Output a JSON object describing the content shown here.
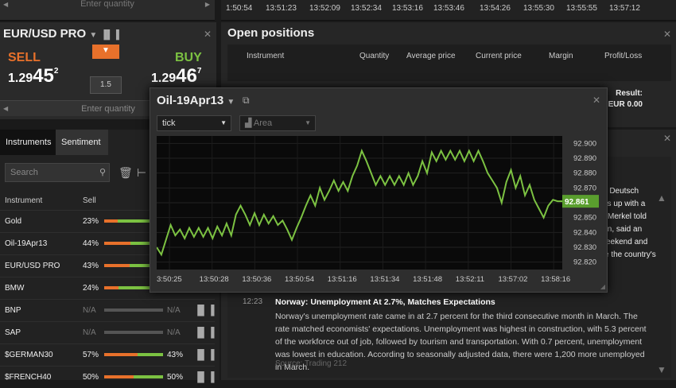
{
  "top_left": {
    "placeholder": "Enter quantity"
  },
  "top_times": [
    "1:50:54",
    "13:51:23",
    "13:52:09",
    "13:52:34",
    "13:53:16",
    "13:53:46",
    "13:54:26",
    "13:55:30",
    "13:55:55",
    "13:57:12"
  ],
  "trade": {
    "instrument": "EUR/USD PRO",
    "sell_label": "SELL",
    "buy_label": "BUY",
    "sell_big": "1.29",
    "sell_pips": "45",
    "sell_sup": "2",
    "buy_big": "1.29",
    "buy_pips": "46",
    "buy_sup": "7",
    "spread": "1.5",
    "quantity_placeholder": "Enter quantity"
  },
  "instruments_panel": {
    "tabs": [
      "Instruments",
      "Sentiment"
    ],
    "search_placeholder": "Search",
    "col_instrument": "Instrument",
    "col_sell": "Sell",
    "rows": [
      {
        "name": "Gold",
        "sell": "23%",
        "buy": "",
        "sell_frac": 0.23
      },
      {
        "name": "Oil-19Apr13",
        "sell": "44%",
        "buy": "",
        "sell_frac": 0.44
      },
      {
        "name": "EUR/USD PRO",
        "sell": "43%",
        "buy": "",
        "sell_frac": 0.43
      },
      {
        "name": "BMW",
        "sell": "24%",
        "buy": "",
        "sell_frac": 0.24
      },
      {
        "name": "BNP",
        "sell": "N/A",
        "buy": "N/A",
        "sell_frac": 0
      },
      {
        "name": "SAP",
        "sell": "N/A",
        "buy": "N/A",
        "sell_frac": 0
      },
      {
        "name": "$GERMAN30",
        "sell": "57%",
        "buy": "43%",
        "sell_frac": 0.57
      },
      {
        "name": "$FRENCH40",
        "sell": "50%",
        "buy": "50%",
        "sell_frac": 0.5
      }
    ]
  },
  "open_positions": {
    "title": "Open positions",
    "columns": [
      "Instrument",
      "Quantity",
      "Average price",
      "Current price",
      "Margin",
      "Profit/Loss"
    ],
    "result_label": "Result:",
    "result_value": "EUR 0.00"
  },
  "news": {
    "snippets": [
      "h Deutsch",
      "es up with a",
      "Merkel told",
      "lan, said an",
      "eekend and",
      "e the country's"
    ],
    "time": "12:23",
    "headline": "Norway: Unemployment At 2.7%, Matches Expectations",
    "body": "Norway's unemployment rate came in at 2.7 percent for the third consecutive month in March. The rate matched economists' expectations. Unemployment was highest in construction, with 5.3 percent of the workforce out of job, followed by tourism and transportation. With 0.7 percent, unemployment was lowest in education. According to seasonally adjusted data, there were 1,200 more unemployed in March.",
    "source": "Source: Trading 212"
  },
  "popup": {
    "title": "Oil-19Apr13",
    "interval": "tick",
    "chart_type": "Area"
  },
  "chart_data": {
    "type": "line",
    "x_ticks": [
      "3:50:25",
      "13:50:28",
      "13:50:36",
      "13:50:54",
      "13:51:16",
      "13:51:34",
      "13:51:48",
      "13:52:11",
      "13:57:02",
      "13:58:16"
    ],
    "y_ticks": [
      "92.900",
      "92.890",
      "92.880",
      "92.870",
      "92.860",
      "92.850",
      "92.840",
      "92.830",
      "92.820"
    ],
    "ylim": [
      92.815,
      92.905
    ],
    "current": "92.861",
    "values": [
      92.83,
      92.825,
      92.835,
      92.845,
      92.838,
      92.842,
      92.836,
      92.843,
      92.837,
      92.843,
      92.837,
      92.843,
      92.836,
      92.844,
      92.838,
      92.846,
      92.838,
      92.852,
      92.858,
      92.852,
      92.845,
      92.853,
      92.845,
      92.852,
      92.846,
      92.851,
      92.845,
      92.848,
      92.842,
      92.835,
      92.843,
      92.85,
      92.858,
      92.865,
      92.858,
      92.87,
      92.862,
      92.868,
      92.875,
      92.868,
      92.874,
      92.868,
      92.878,
      92.885,
      92.895,
      92.888,
      92.88,
      92.872,
      92.878,
      92.872,
      92.878,
      92.872,
      92.878,
      92.872,
      92.88,
      92.872,
      92.878,
      92.888,
      92.88,
      92.894,
      92.888,
      92.895,
      92.889,
      92.895,
      92.889,
      92.895,
      92.888,
      92.895,
      92.888,
      92.895,
      92.888,
      92.88,
      92.875,
      92.87,
      92.86,
      92.874,
      92.882,
      92.87,
      92.878,
      92.865,
      92.872,
      92.862,
      92.856,
      92.85,
      92.858,
      92.862,
      92.861,
      92.861
    ],
    "line_color": "#7cc242",
    "current_color": "#5a9e2e"
  },
  "colors": {
    "sell": "#e8712b",
    "buy": "#7cc242"
  }
}
